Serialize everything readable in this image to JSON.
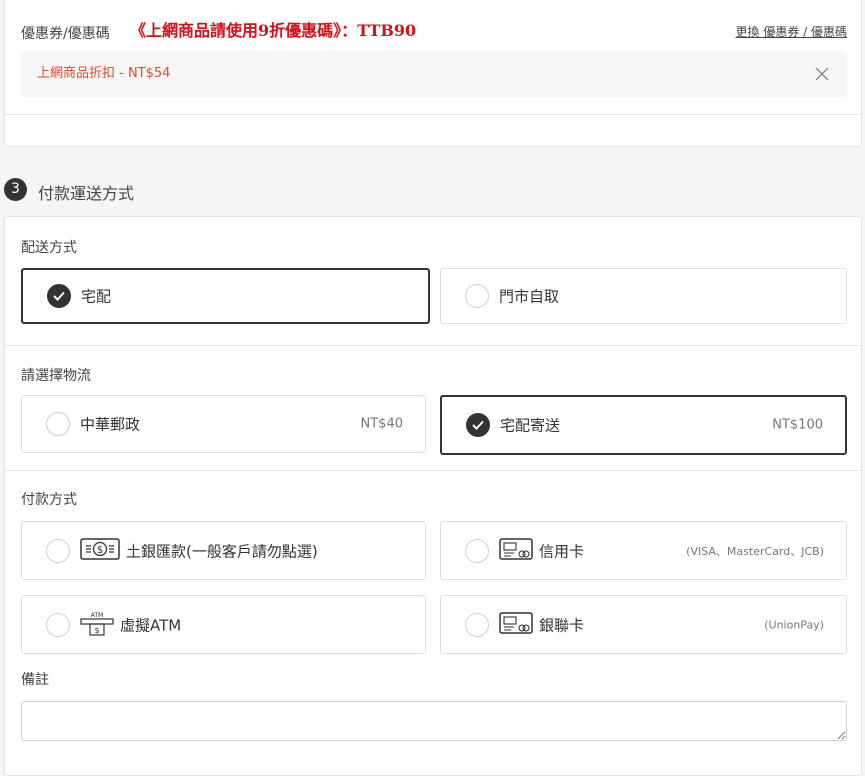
{
  "coupon": {
    "label": "優惠券/優惠碼",
    "promo": "《上網商品請使用9折優惠碼》：TTB90",
    "change_link": "更換 優惠券 / 優惠碼",
    "applied": "上網商品折扣 - NT$54",
    "close_icon": "close-icon"
  },
  "step": {
    "number": "3",
    "title": "付款運送方式"
  },
  "shipping": {
    "label": "配送方式",
    "options": [
      {
        "label": "宅配",
        "selected": true
      },
      {
        "label": "門市自取",
        "selected": false
      }
    ]
  },
  "logistics": {
    "label": "請選擇物流",
    "options": [
      {
        "label": "中華郵政",
        "price": "NT$40",
        "selected": false
      },
      {
        "label": "宅配寄送",
        "price": "NT$100",
        "selected": true
      }
    ]
  },
  "payment": {
    "label": "付款方式",
    "options": [
      {
        "label": "土銀匯款(一般客戶請勿點選)",
        "icon": "cash-icon",
        "note": "",
        "selected": false
      },
      {
        "label": "信用卡",
        "icon": "card-icon",
        "note": "(VISA、MasterCard、JCB)",
        "selected": false
      },
      {
        "label": "虛擬ATM",
        "icon": "atm-icon",
        "icon_text": "ATM",
        "note": "",
        "selected": false
      },
      {
        "label": "銀聯卡",
        "icon": "card-icon",
        "note": "(UnionPay)",
        "selected": false
      }
    ]
  },
  "remark": {
    "label": "備註",
    "value": ""
  }
}
